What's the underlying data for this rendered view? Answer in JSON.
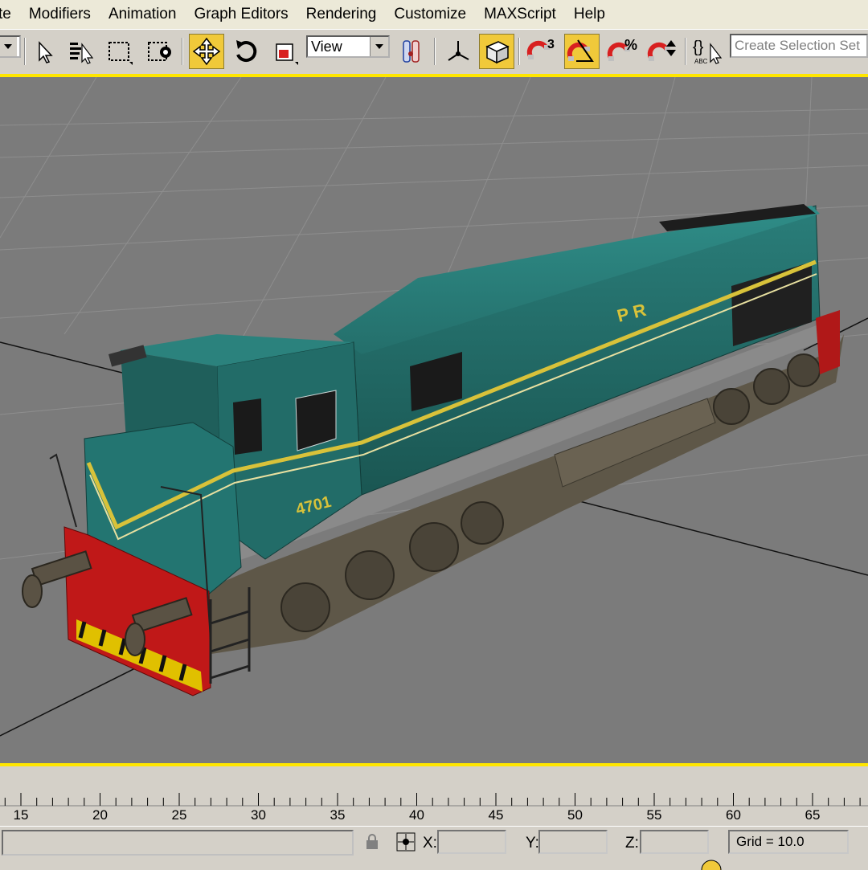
{
  "menu": {
    "items": [
      "te",
      "Modifiers",
      "Animation",
      "Graph Editors",
      "Rendering",
      "Customize",
      "MAXScript",
      "Help"
    ]
  },
  "toolbar": {
    "reference_coord_value": "View",
    "named_selection_placeholder": "Create Selection Set",
    "angle_snap_label": "3",
    "percent_snap_label": "%",
    "edit_named_label": "{}",
    "abc_label": "ABC"
  },
  "viewport": {
    "model_name": "P R",
    "background_color": "#7b7b7b",
    "model_number": "4701"
  },
  "timeline": {
    "ticks": [
      "15",
      "20",
      "25",
      "30",
      "35",
      "40",
      "45",
      "50",
      "55",
      "60",
      "65"
    ]
  },
  "status": {
    "x_label": "X:",
    "y_label": "Y:",
    "z_label": "Z:",
    "grid_text": "Grid = 10.0"
  },
  "colors": {
    "accent": "#ffe600",
    "active_button": "#f0c93a",
    "ui_gray": "#d4d0c8"
  }
}
